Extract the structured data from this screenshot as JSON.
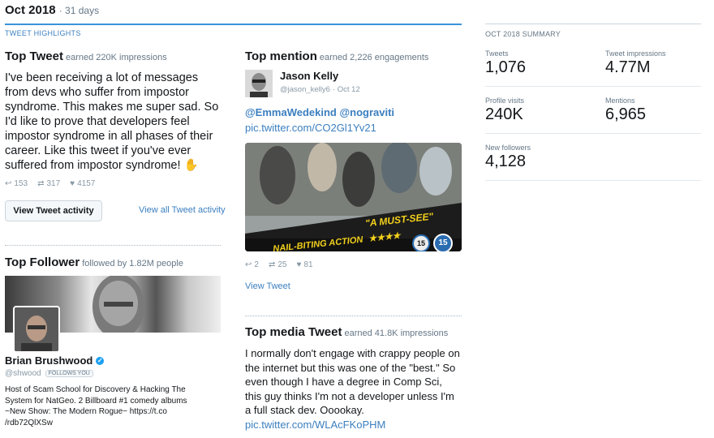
{
  "header": {
    "month": "Oct 2018",
    "days": "· 31 days"
  },
  "highlights_label": "TWEET HIGHLIGHTS",
  "top_tweet": {
    "title": "Top Tweet",
    "subtitle": "earned 220K impressions",
    "text": "I've been receiving a lot of messages from devs who suffer from impostor syndrome. This makes me super sad. So I'd like to prove that developers feel impostor syndrome in all phases of their career. Like this tweet if you've ever suffered from impostor syndrome! ✋",
    "replies": "153",
    "retweets": "317",
    "likes": "4157",
    "button": "View Tweet activity",
    "link": "View all Tweet activity"
  },
  "top_follower": {
    "title": "Top Follower",
    "subtitle": "followed by 1.82M people",
    "name": "Brian Brushwood",
    "handle": "@shwood",
    "follows_badge": "FOLLOWS YOU",
    "bio": "Host of Scam School for Discovery & Hacking The System for NatGeo. 2 Billboard #1 comedy albums ~New Show: The Modern Rogue~ https://t.co /rdb72QlXSw"
  },
  "top_mention": {
    "title": "Top mention",
    "subtitle": "earned 2,226 engagements",
    "name": "Jason Kelly",
    "handle": "@jason_kelly6",
    "date": "· Oct 12",
    "mentions": "@EmmaWedekind @nograviti",
    "pic_link": "pic.twitter.com/CO2Gl1Yv21",
    "poster_text_left": "NAIL-BITING ACTION",
    "poster_text_right": "\"A MUST-SEE\"",
    "poster_stars": "★★★★",
    "poster_rating": "15",
    "replies": "2",
    "retweets": "25",
    "likes": "81",
    "view_link": "View Tweet"
  },
  "top_media": {
    "title": "Top media Tweet",
    "subtitle": "earned 41.8K impressions",
    "text": "I normally don't engage with crappy people on the internet but this was one of the \"best.\" So even though I have a degree in Comp Sci, this guy thinks I'm not a developer unless I'm a full stack dev. Ooookay.",
    "link": "pic.twitter.com/WLAcFKoPHM"
  },
  "summary": {
    "label": "OCT 2018 SUMMARY",
    "tweets_label": "Tweets",
    "tweets": "1,076",
    "impressions_label": "Tweet impressions",
    "impressions": "4.77M",
    "visits_label": "Profile visits",
    "visits": "240K",
    "mentions_label": "Mentions",
    "mentions": "6,965",
    "followers_label": "New followers",
    "followers": "4,128"
  },
  "colors": {
    "link": "#3b7fbf",
    "accent_line": "#3b94d9",
    "verified": "#1da1f2"
  }
}
